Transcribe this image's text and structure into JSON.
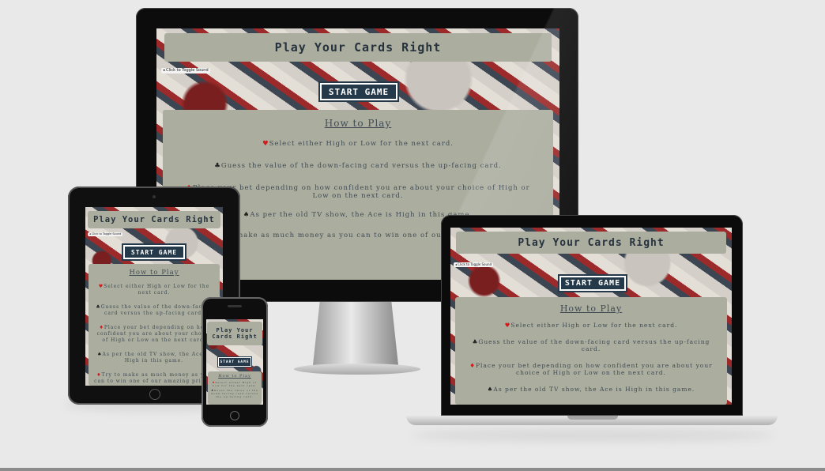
{
  "app": {
    "title": "Play Your Cards Right",
    "sound_toggle": "Click to Toggle Sound",
    "start_button": "START GAME",
    "how_to_heading": "How to Play",
    "rules": [
      "Select either High or Low for the next card.",
      "Guess the value of the down-facing card versus the up-facing card.",
      "Place your bet depending on how confident you are about your choice of High or Low on the next card.",
      "As per the old TV show, the Ace is High in this game.",
      "Try to make as much money as you can to win one of our amazing prizes!"
    ],
    "suit_icons": [
      "heart-icon",
      "club-icon",
      "diamond-icon",
      "spade-icon",
      "diamond-icon"
    ]
  },
  "colors": {
    "page_bg": "#e9e9e9",
    "panel_bg": "#abae9f",
    "title_text": "#26323d",
    "button_bg": "#24394a",
    "suit_red": "#d21a1a"
  }
}
